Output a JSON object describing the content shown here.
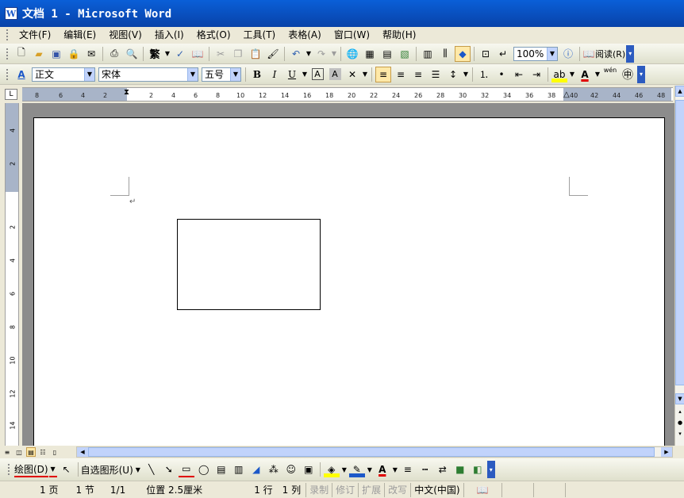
{
  "window": {
    "title": "文档 1 - Microsoft Word",
    "icon": "word-doc-icon"
  },
  "menu": {
    "items": [
      "文件(F)",
      "编辑(E)",
      "视图(V)",
      "插入(I)",
      "格式(O)",
      "工具(T)",
      "表格(A)",
      "窗口(W)",
      "帮助(H)"
    ]
  },
  "standard_toolbar": {
    "trad_chinese": "繁",
    "zoom": "100%",
    "read_label": "阅读(R)"
  },
  "format_toolbar": {
    "style": "正文",
    "font": "宋体",
    "size": "五号",
    "bold": "B",
    "italic": "I",
    "underline": "U",
    "char_border": "A",
    "char_shading": "A",
    "font_color_label": "A",
    "pinyin_label": "wén"
  },
  "ruler": {
    "corner": "L",
    "h_ticks": [
      "8",
      "6",
      "4",
      "2",
      "2",
      "4",
      "6",
      "8",
      "10",
      "12",
      "14",
      "16",
      "18",
      "20",
      "22",
      "24",
      "26",
      "28",
      "30",
      "32",
      "34",
      "36",
      "38",
      "40",
      "42",
      "44",
      "46",
      "48"
    ],
    "v_ticks": [
      "4",
      "2",
      "2",
      "4",
      "6",
      "8",
      "10",
      "12",
      "14"
    ]
  },
  "drawing_toolbar": {
    "draw_label": "绘图(D)",
    "autoshapes_label": "自选图形(U)",
    "font_color": "A"
  },
  "status": {
    "page": "1 页",
    "section": "1 节",
    "pages": "1/1",
    "position": "位置 2.5厘米",
    "line": "1 行",
    "column": "1 列",
    "rec": "录制",
    "trk": "修订",
    "ext": "扩展",
    "ovr": "改写",
    "language": "中文(中国)"
  },
  "colors": {
    "titlebar": "#0842a8",
    "accent_red": "#e00000",
    "highlight": "#ffe9a8"
  }
}
